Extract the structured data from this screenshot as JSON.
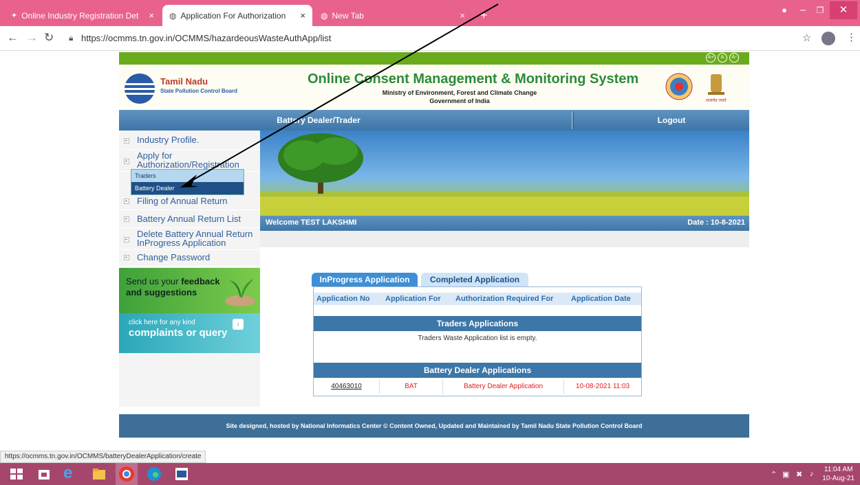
{
  "browser": {
    "tabs": [
      {
        "label": "Online Industry Registration Det",
        "close": "×"
      },
      {
        "label": "Application For Authorization",
        "close": "×"
      },
      {
        "label": "New Tab",
        "close": "×"
      }
    ],
    "new_tab": "+",
    "url": "https://ocmms.tn.gov.in/OCMMS/hazardeousWasteAuthApp/list",
    "status_url": "https://ocmms.tn.gov.in/OCMMS/batteryDealerApplication/create"
  },
  "header": {
    "accessibility": [
      "A+",
      "A",
      "A-"
    ],
    "org_title": "Tamil Nadu",
    "org_subtitle": "State Pollution Control Board",
    "main_title": "Online Consent Management & Monitoring System",
    "ministry": "Ministry of Environment, Forest and Climate Change",
    "government": "Government of India",
    "emblem_text": "सत्यमेव जयते"
  },
  "menubar": {
    "role": "Battery Dealer/Trader",
    "logout": "Logout"
  },
  "sidebar": {
    "items": [
      {
        "label": "Industry Profile."
      },
      {
        "label": "Apply for Authorization/Registration"
      },
      {
        "label": "Filing of Annual Return"
      },
      {
        "label": "Battery Annual Return List"
      },
      {
        "label": "Delete Battery Annual Return InProgress Application"
      },
      {
        "label": "Change Password"
      }
    ],
    "submenu": [
      "Traders",
      "Battery Dealer"
    ],
    "feedback_line1": "Send us your",
    "feedback_bold": "feedback",
    "feedback_line2": "and suggestions",
    "complaint_line1": "click here for any kind",
    "complaint_line2": "complaints or query"
  },
  "welcome": {
    "text": "Welcome TEST LAKSHMI",
    "date": "Date : 10-8-2021"
  },
  "applications": {
    "tabs": [
      "InProgress Application",
      "Completed Application"
    ],
    "columns": [
      "Application No",
      "Application For",
      "Authorization Required For",
      "Application Date"
    ],
    "traders_heading": "Traders Applications",
    "traders_empty": "Traders Waste Application list is empty.",
    "battery_heading": "Battery Dealer Applications",
    "rows": [
      {
        "no": "40463010",
        "for": "BAT",
        "required": "Battery Dealer Application",
        "date": "10-08-2021 11:03"
      }
    ]
  },
  "footer": {
    "text": "Site designed, hosted by National Informatics Center © Content Owned, Updated and Maintained by Tamil Nadu State Pollution Control Board"
  },
  "taskbar": {
    "time": "11:04 AM",
    "date": "10-Aug-21"
  },
  "colors": {
    "tab_bar": "#e8628c",
    "menu_blue": "#3d76a8",
    "title_green": "#2d8a3a",
    "taskbar": "#a5476c"
  }
}
